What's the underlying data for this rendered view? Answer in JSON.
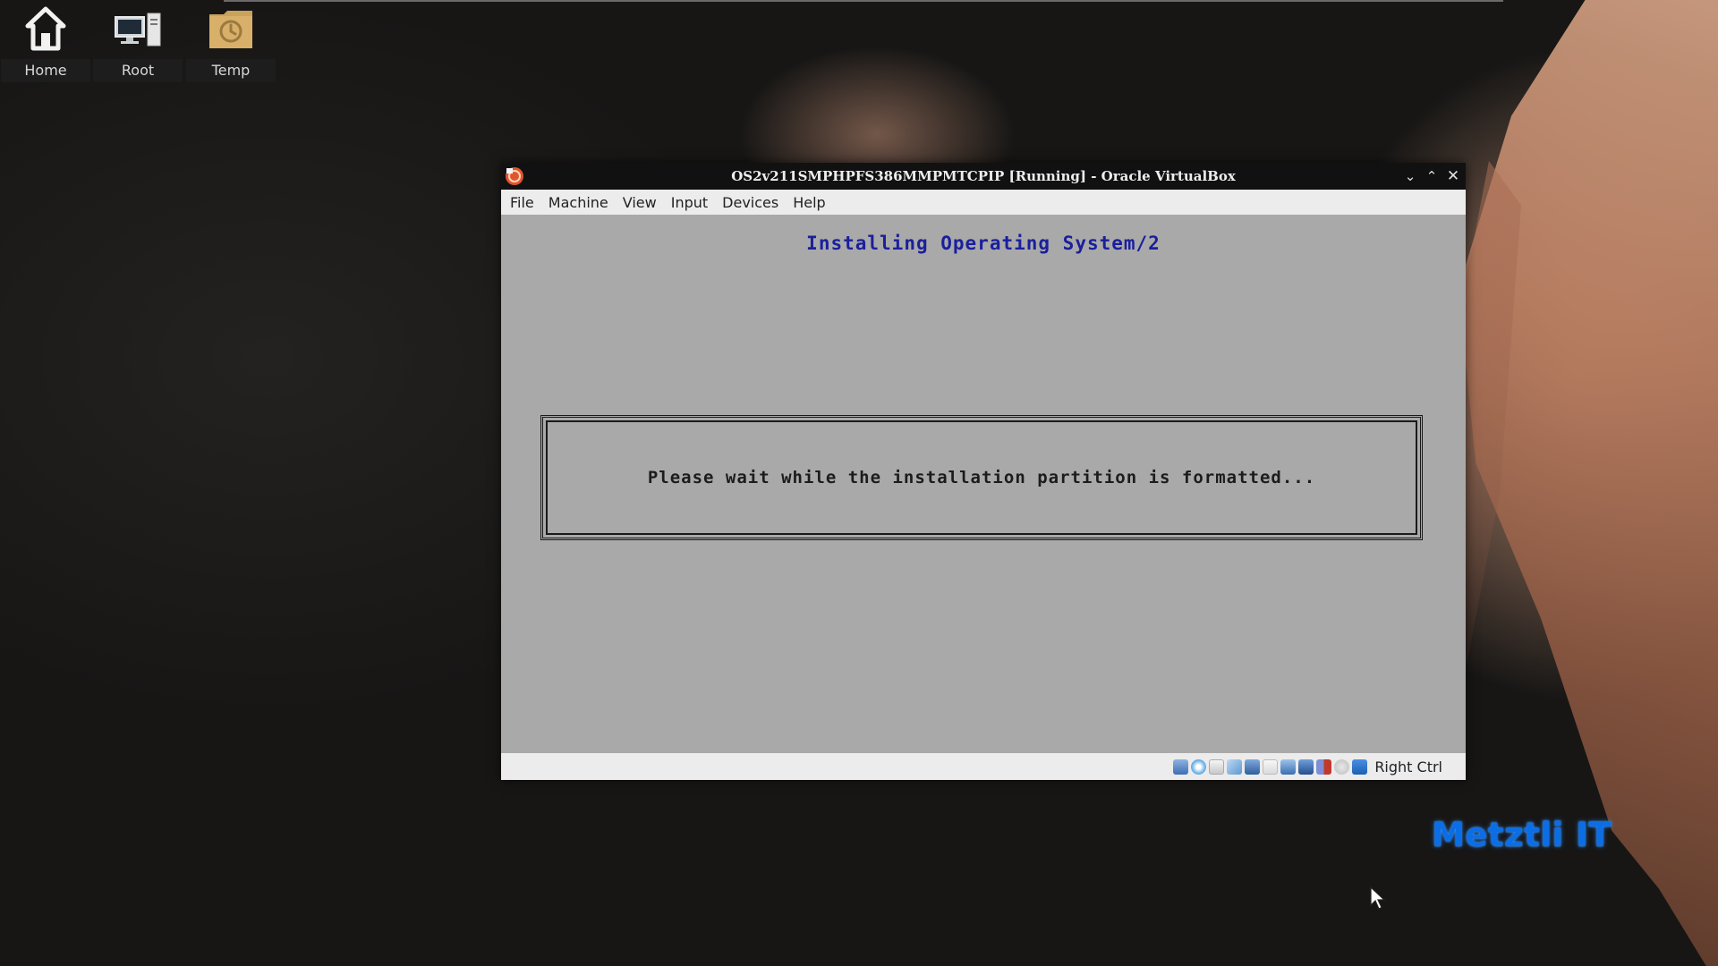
{
  "desktop": {
    "icons": [
      {
        "label": "Home",
        "icon": "home-icon"
      },
      {
        "label": "Root",
        "icon": "computer-icon"
      },
      {
        "label": "Temp",
        "icon": "folder-clock-icon"
      }
    ],
    "watermark": "Metztli IT"
  },
  "window": {
    "title": "OS2v211SMPHPFS386MMPMTCPIP [Running] - Oracle VirtualBox",
    "menu": [
      "File",
      "Machine",
      "View",
      "Input",
      "Devices",
      "Help"
    ],
    "screen": {
      "heading": "Installing Operating System/2",
      "message": "Please wait while the installation partition is formatted..."
    },
    "status": {
      "host_key": "Right Ctrl",
      "icons": [
        "hard-disk-icon",
        "optical-drive-icon",
        "floppy-icon",
        "audio-icon",
        "network-icon",
        "usb-icon",
        "shared-folder-icon",
        "display-icon",
        "video-capture-icon",
        "cpu-icon",
        "mouse-integration-icon",
        "keyboard-capture-icon"
      ]
    }
  },
  "colors": {
    "vm_heading": "#1a1f9c",
    "vm_background": "#a9a9a9",
    "watermark": "#0c6ee6"
  }
}
